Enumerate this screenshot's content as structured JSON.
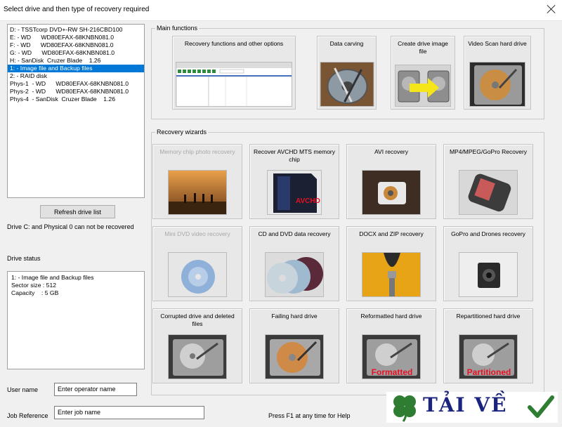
{
  "window": {
    "title": "Select drive and then type of recovery required"
  },
  "drives": [
    "D: - TSSTcorp DVD+-RW SH-216CBD100",
    "E: - WD      WD80EFAX-68KNBN081.0",
    "F: - WD      WD80EFAX-68KNBN081.0",
    "G: - WD      WD80EFAX-68KNBN081.0",
    "H: - SanDisk  Cruzer Blade    1.26",
    "1: - Image file and Backup files",
    "2: - RAID disk",
    "Phys-1  - WD      WD80EFAX-68KNBN081.0",
    "Phys-2  - WD      WD80EFAX-68KNBN081.0",
    "Phys-4  - SanDisk  Cruzer Blade    1.26"
  ],
  "selected_drive_index": 5,
  "refresh_button": "Refresh drive list",
  "warning": "Drive C: and Physical 0 can not be recovered",
  "drive_status": {
    "label": "Drive status",
    "lines": [
      "1: - Image file and Backup files",
      "Sector size : 512",
      "Capacity    : 5 GB"
    ]
  },
  "user_name": {
    "label": "User name",
    "value": "Enter operator name"
  },
  "job_reference": {
    "label": "Job Reference",
    "value": "Enter job name"
  },
  "help_text": "Press F1 at any time for Help",
  "main_functions": {
    "title": "Main functions",
    "tiles": [
      {
        "label": "Recovery functions and other options"
      },
      {
        "label": "Data carving"
      },
      {
        "label": "Create drive image file"
      },
      {
        "label": "Video Scan hard drive"
      }
    ]
  },
  "recovery_wizards": {
    "title": "Recovery wizards",
    "tiles": [
      {
        "label": "Memory chip photo recovery",
        "enabled": false
      },
      {
        "label": "Recover AVCHD MTS memory chip",
        "enabled": true,
        "image_text": "AVCHD"
      },
      {
        "label": "AVI recovery",
        "enabled": true
      },
      {
        "label": "MP4/MPEG/GoPro Recovery",
        "enabled": true
      },
      {
        "label": "Mini DVD video recovery",
        "enabled": false
      },
      {
        "label": "CD and DVD data recovery",
        "enabled": true
      },
      {
        "label": "DOCX and ZIP recovery",
        "enabled": true
      },
      {
        "label": "GoPro and Drones recovery",
        "enabled": true
      },
      {
        "label": "Corrupted drive and deleted files",
        "enabled": true
      },
      {
        "label": "Failing hard drive",
        "enabled": true
      },
      {
        "label": "Reformatted hard drive",
        "enabled": true,
        "image_text": "Formatted"
      },
      {
        "label": "Repartitioned hard drive",
        "enabled": true,
        "image_text": "Partitioned"
      }
    ]
  },
  "logo": {
    "text": "TẢI VỀ"
  },
  "colors": {
    "selection": "#0078d7",
    "accent_red": "#e81123",
    "logo_blue": "#1a237e",
    "logo_green": "#2e7d32"
  }
}
